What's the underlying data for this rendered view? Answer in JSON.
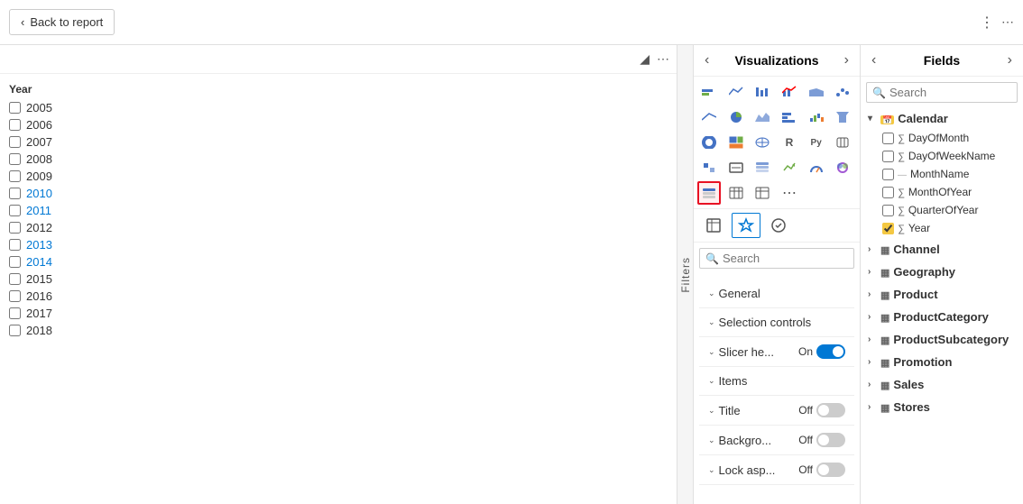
{
  "topbar": {
    "back_label": "Back to report"
  },
  "canvas": {
    "year_label": "Year",
    "years": [
      {
        "value": "2005",
        "checked": false,
        "color": "normal"
      },
      {
        "value": "2006",
        "checked": false,
        "color": "normal"
      },
      {
        "value": "2007",
        "checked": false,
        "color": "normal"
      },
      {
        "value": "2008",
        "checked": false,
        "color": "normal"
      },
      {
        "value": "2009",
        "checked": false,
        "color": "normal"
      },
      {
        "value": "2010",
        "checked": false,
        "color": "blue"
      },
      {
        "value": "2011",
        "checked": false,
        "color": "blue"
      },
      {
        "value": "2012",
        "checked": false,
        "color": "normal"
      },
      {
        "value": "2013",
        "checked": false,
        "color": "blue"
      },
      {
        "value": "2014",
        "checked": false,
        "color": "blue"
      },
      {
        "value": "2015",
        "checked": false,
        "color": "normal"
      },
      {
        "value": "2016",
        "checked": false,
        "color": "normal"
      },
      {
        "value": "2017",
        "checked": false,
        "color": "normal"
      },
      {
        "value": "2018",
        "checked": false,
        "color": "normal"
      }
    ]
  },
  "visualizations": {
    "title": "Visualizations",
    "search_placeholder": "Search",
    "format_sections": [
      {
        "label": "General",
        "has_value": false,
        "value": ""
      },
      {
        "label": "Selection controls",
        "has_value": false,
        "value": ""
      },
      {
        "label": "Slicer he...",
        "has_value": true,
        "value": "On"
      },
      {
        "label": "Items",
        "has_value": false,
        "value": ""
      },
      {
        "label": "Title",
        "has_value": true,
        "value": "Off"
      },
      {
        "label": "Backgro...",
        "has_value": true,
        "value": "Off"
      },
      {
        "label": "Lock asp...",
        "has_value": true,
        "value": "Off"
      }
    ]
  },
  "fields": {
    "title": "Fields",
    "search_placeholder": "Search",
    "groups": [
      {
        "name": "Calendar",
        "icon": "calendar",
        "expanded": true,
        "items": [
          {
            "name": "DayOfMonth",
            "type": "sigma",
            "checked": false
          },
          {
            "name": "DayOfWeekName",
            "type": "sigma",
            "checked": false
          },
          {
            "name": "MonthName",
            "type": "normal",
            "checked": false
          },
          {
            "name": "MonthOfYear",
            "type": "sigma",
            "checked": false
          },
          {
            "name": "QuarterOfYear",
            "type": "sigma",
            "checked": false
          },
          {
            "name": "Year",
            "type": "sigma",
            "checked": true
          }
        ]
      },
      {
        "name": "Channel",
        "icon": "table",
        "expanded": false,
        "items": []
      },
      {
        "name": "Geography",
        "icon": "table",
        "expanded": false,
        "items": []
      },
      {
        "name": "Product",
        "icon": "table",
        "expanded": false,
        "items": []
      },
      {
        "name": "ProductCategory",
        "icon": "table",
        "expanded": false,
        "items": []
      },
      {
        "name": "ProductSubcategory",
        "icon": "table",
        "expanded": false,
        "items": []
      },
      {
        "name": "Promotion",
        "icon": "table",
        "expanded": false,
        "items": []
      },
      {
        "name": "Sales",
        "icon": "table",
        "expanded": false,
        "items": []
      },
      {
        "name": "Stores",
        "icon": "table",
        "expanded": false,
        "items": []
      }
    ]
  },
  "filters_label": "Filters"
}
